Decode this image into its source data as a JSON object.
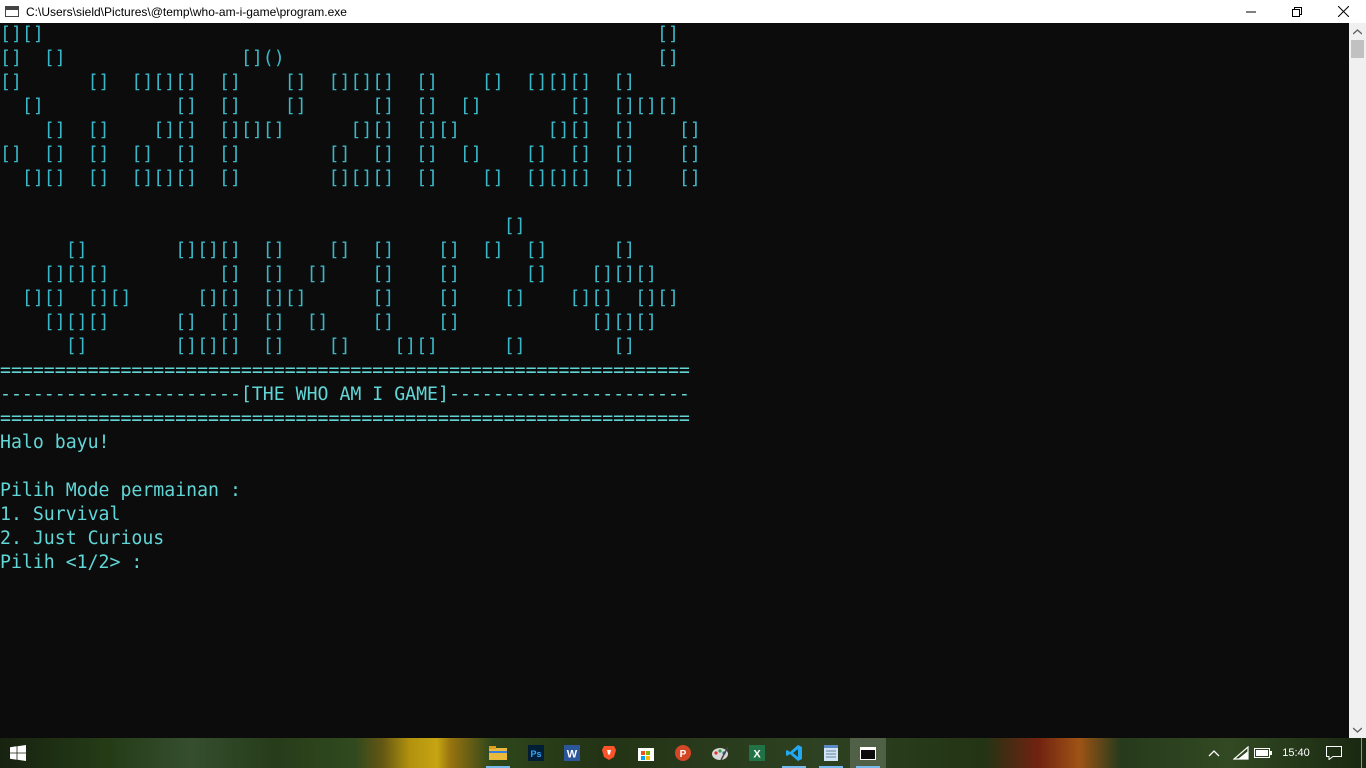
{
  "window": {
    "title": "C:\\Users\\sield\\Pictures\\@temp\\who-am-i-game\\program.exe",
    "icon": "console-app-icon",
    "controls": [
      "minimize-icon",
      "restore-icon",
      "close-icon"
    ]
  },
  "console": {
    "art_lines": [
      "[][]                                                        []",
      "[]  []                []()                                  []",
      "[]      []  [][][]  []    []  [][][]  []    []  [][][]  []",
      "  []            []  []    []      []  []  []        []  [][][]",
      "    []  []    [][]  [][][]      [][]  [][]        [][]  []    []",
      "[]  []  []  []  []  []        []  []  []  []    []  []  []    []",
      "  [][]  []  [][][]  []        [][][]  []    []  [][][]  []    []",
      "",
      "                                              []",
      "      []        [][][]  []    []  []    []  []  []      []",
      "    [][][]          []  []  []    []    []      []    [][][]",
      "  [][]  [][]      [][]  [][]      []    []    []    [][]  [][]",
      "    [][][]      []  []  []  []    []    []            [][][]",
      "      []        [][][]  []    []    [][]      []        []"
    ],
    "separator_top": "===============================================================",
    "title_line": "----------------------[THE WHO AM I GAME]----------------------",
    "separator_bottom": "===============================================================",
    "greeting": "Halo bayu!",
    "menu_prompt": "Pilih Mode permainan :",
    "options": [
      "1. Survival",
      "2. Just Curious"
    ],
    "choice_prompt": "Pilih <1/2> :"
  },
  "taskbar": {
    "start": "windows-start-icon",
    "apps": [
      {
        "name": "file-explorer-icon",
        "running": true
      },
      {
        "name": "photoshop-icon",
        "label": "Ps",
        "running": false
      },
      {
        "name": "word-icon",
        "label": "W",
        "running": false
      },
      {
        "name": "brave-browser-icon",
        "running": false
      },
      {
        "name": "microsoft-store-icon",
        "running": false
      },
      {
        "name": "powerpoint-icon",
        "label": "P",
        "running": false
      },
      {
        "name": "paint-icon",
        "running": false
      },
      {
        "name": "excel-icon",
        "label": "X",
        "running": false
      },
      {
        "name": "vscode-icon",
        "running": true
      },
      {
        "name": "notepad-icon",
        "running": true
      },
      {
        "name": "console-window-icon",
        "running": true,
        "active": true
      }
    ],
    "tray": [
      "chevron-up-icon",
      "wifi-icon",
      "battery-icon"
    ],
    "clock": "15:40",
    "notification": "notification-icon"
  }
}
